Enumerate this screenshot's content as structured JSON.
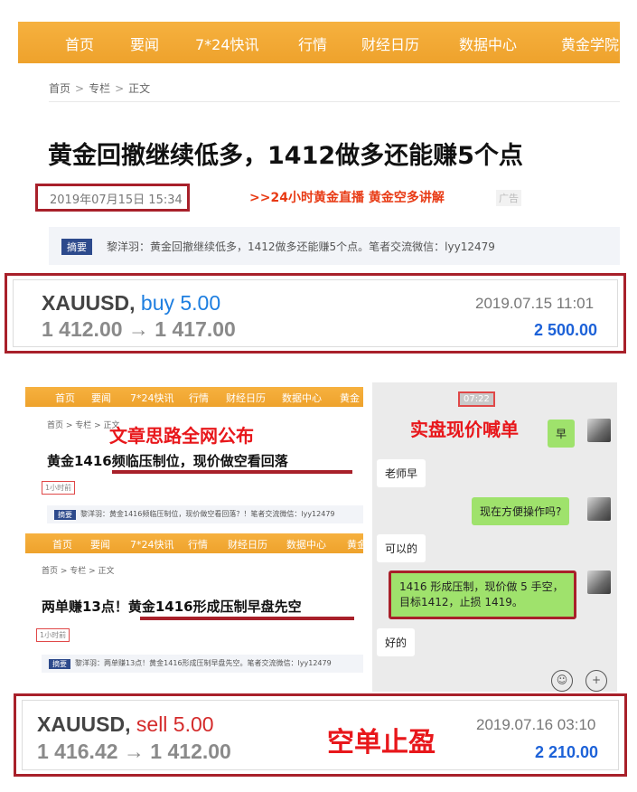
{
  "nav": {
    "items": [
      "首页",
      "要闻",
      "7*24快讯",
      "行情",
      "财经日历",
      "数据中心",
      "黄金学院"
    ]
  },
  "breadcrumb": [
    "首页",
    "专栏",
    "正文"
  ],
  "breadcrumb_sep": ">",
  "article": {
    "title": "黄金回撤继续低多，1412做多还能赚5个点",
    "date": "2019年07月15日 15:34",
    "promo_link": ">>24小时黄金直播 黄金空多讲解",
    "ad_label": "广告",
    "summary_tag": "摘要",
    "summary_text": "黎洋羽：黄金回撤继续低多，1412做多还能赚5个点。笔者交流微信：lyy12479"
  },
  "trade1": {
    "symbol": "XAUUSD,",
    "side": "buy 5.00",
    "prices": "1 412.00 → 1 417.00",
    "time": "2019.07.15 11:01",
    "profit": "2 500.00"
  },
  "composite": {
    "nav_items": [
      "首页",
      "要闻",
      "7*24快讯",
      "行情",
      "财经日历",
      "数据中心",
      "黄金"
    ],
    "crumb": "首页 > 专栏 > 正文",
    "overlay_left": "文章思路全网公布",
    "overlay_right": "实盘现价喊单",
    "article1": {
      "title": "黄金1416频临压制位，现价做空看回落",
      "time": "1小时前",
      "summary_tag": "摘要",
      "summary": "黎洋羽：黄金1416频临压制位，现价做空看回落？！笔者交流微信：lyy12479"
    },
    "article2": {
      "title_prefix": "两单赚13点！",
      "title_main": "黄金1416形成压制早盘先空",
      "time": "1小时前",
      "summary_tag": "摘要",
      "summary": "黎洋羽：两单赚13点！黄金1416形成压制早盘先空。笔者交流微信：lyy12479"
    }
  },
  "chat": {
    "time": "07:22",
    "messages": [
      {
        "from": "me",
        "text": "早"
      },
      {
        "from": "other",
        "text": "老师早"
      },
      {
        "from": "me",
        "text": "现在方便操作吗?"
      },
      {
        "from": "other",
        "text": "可以的"
      },
      {
        "from": "me",
        "text": "1416 形成压制，现价做 5 手空，目标1412，止损 1419。"
      },
      {
        "from": "other",
        "text": "好的"
      }
    ]
  },
  "trade2": {
    "symbol": "XAUUSD,",
    "side": "sell 5.00",
    "prices": "1 416.42 → 1 412.00",
    "time": "2019.07.16 03:10",
    "profit": "2 210.00",
    "stamp": "空单止盈"
  },
  "colors": {
    "nav_orange": "#f0a630",
    "frame_red": "#a8202a",
    "buy_blue": "#1d7ee0",
    "sell_red": "#d42a2a",
    "profit_blue": "#1d62d8",
    "wechat_green": "#9fe26c"
  }
}
